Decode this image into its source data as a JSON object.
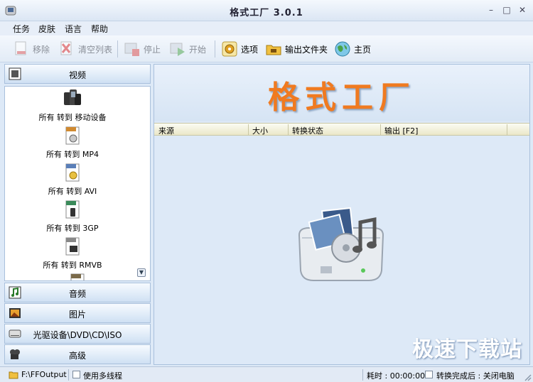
{
  "window": {
    "title": "格式工厂 3.0.1"
  },
  "menu": [
    "任务",
    "皮肤",
    "语言",
    "帮助"
  ],
  "toolbar": {
    "remove": "移除",
    "clear_list": "清空列表",
    "stop": "停止",
    "start": "开始",
    "options": "选项",
    "output_folder": "输出文件夹",
    "home": "主页"
  },
  "sidebar": {
    "video": "视频",
    "video_items": [
      {
        "label": "所有 转到 移动设备",
        "icon": "mobile-devices-icon"
      },
      {
        "label": "所有 转到 MP4",
        "icon": "mp4-file-icon"
      },
      {
        "label": "所有 转到 AVI",
        "icon": "avi-file-icon"
      },
      {
        "label": "所有 转到 3GP",
        "icon": "3gp-file-icon"
      },
      {
        "label": "所有 转到 RMVB",
        "icon": "rmvb-file-icon"
      }
    ],
    "audio": "音频",
    "picture": "图片",
    "disc": "光驱设备\\DVD\\CD\\ISO",
    "advanced": "高级"
  },
  "main": {
    "banner": "格式工厂",
    "columns": [
      "来源",
      "大小",
      "转换状态",
      "输出 [F2]"
    ],
    "watermark": "极速下载站"
  },
  "status": {
    "output_path": "F:\\FFOutput",
    "multithread": "使用多线程",
    "elapsed": "耗时 : 00:00:00",
    "after_convert": "转换完成后 : 关闭电脑"
  }
}
